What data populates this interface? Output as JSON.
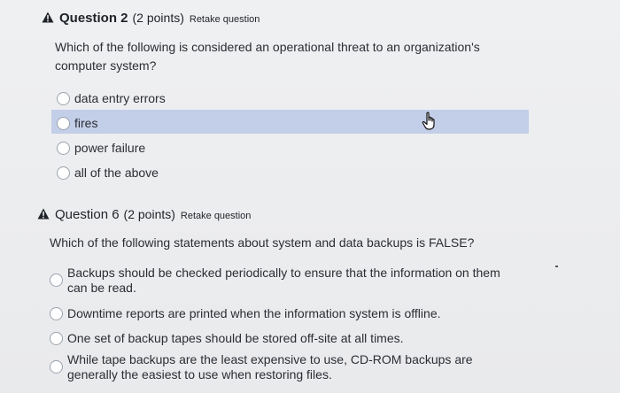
{
  "q2": {
    "title": "Question 2",
    "points": "(2 points)",
    "retake": "Retake question",
    "text_line1": "Which of the following is considered an operational threat to an organization's",
    "text_line2": "computer system?",
    "options": [
      "data entry errors",
      "fires",
      "power failure",
      "all of the above"
    ]
  },
  "q6": {
    "title": "Question 6",
    "points": "(2 points)",
    "retake": "Retake question",
    "text": "Which of the following statements about system and data backups is FALSE?",
    "options": [
      {
        "line1": "Backups should be checked periodically to ensure that the information on them",
        "line2": "can be read."
      },
      {
        "line1": "Downtime reports are printed when the information system is offline."
      },
      {
        "line1": "One set of backup tapes should be stored off-site at all times."
      },
      {
        "line1": "While tape backups are the least expensive to use, CD-ROM backups are",
        "line2": "generally the easiest to use when restoring files."
      }
    ]
  },
  "colors": {
    "highlight": "#c3cee8",
    "radio_border": "#9aa3ae",
    "background": "#ecedef"
  },
  "icons": {
    "warning": "warning-triangle-icon",
    "cursor": "hand-pointer-icon"
  }
}
